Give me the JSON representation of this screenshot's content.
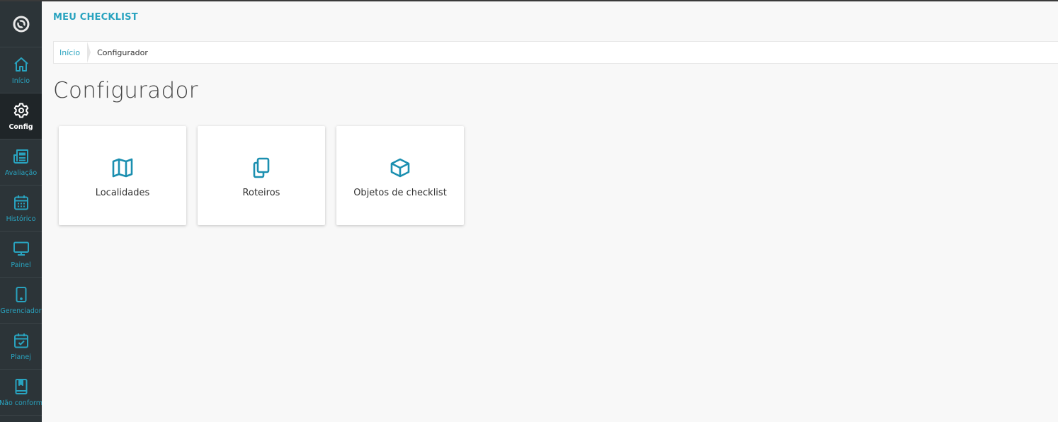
{
  "app": {
    "title": "MEU CHECKLIST"
  },
  "colors": {
    "accent": "#29a3bf",
    "sidebar_bg": "#2c3438",
    "sidebar_active_bg": "#1f2528"
  },
  "sidebar": {
    "logo_icon": "logo-icon",
    "items": [
      {
        "label": "Início",
        "icon": "home-icon",
        "active": false
      },
      {
        "label": "Config",
        "icon": "gear-icon",
        "active": true
      },
      {
        "label": "Avaliação",
        "icon": "newspaper-icon",
        "active": false
      },
      {
        "label": "Histórico",
        "icon": "calendar-icon",
        "active": false
      },
      {
        "label": "Painel",
        "icon": "monitor-icon",
        "active": false
      },
      {
        "label": "Gerenciador",
        "icon": "mobile-icon",
        "active": false
      },
      {
        "label": "Planej",
        "icon": "calendar-check-icon",
        "active": false
      },
      {
        "label": "Não conform",
        "icon": "bookmark-book-icon",
        "active": false
      }
    ]
  },
  "breadcrumb": {
    "home": "Início",
    "current": "Configurador"
  },
  "page": {
    "title": "Configurador"
  },
  "cards": [
    {
      "label": "Localidades",
      "icon": "map-icon"
    },
    {
      "label": "Roteiros",
      "icon": "copy-icon"
    },
    {
      "label": "Objetos de checklist",
      "icon": "box-icon"
    }
  ]
}
